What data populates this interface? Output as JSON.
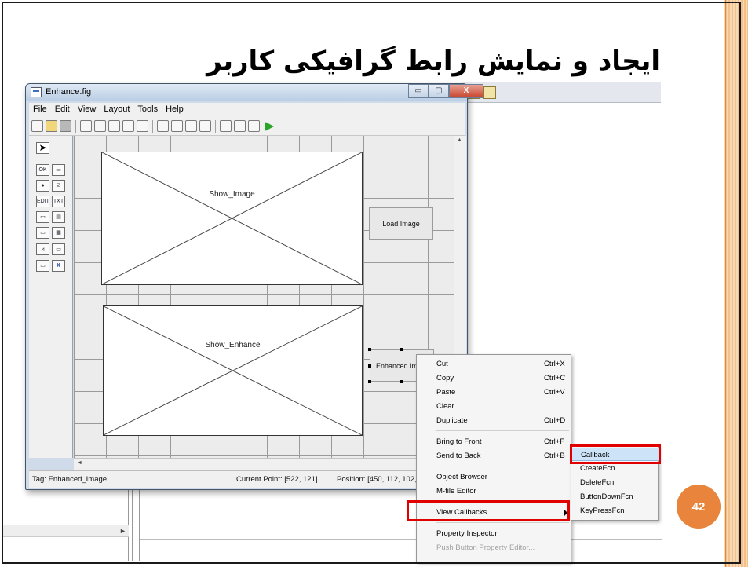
{
  "slide": {
    "title": "ایجاد و نمایش رابط گرافیکی کاربر",
    "page_number": "42"
  },
  "window": {
    "title": "Enhance.fig",
    "buttons": [
      "▭",
      "▢",
      "X"
    ]
  },
  "menubar": [
    "File",
    "Edit",
    "View",
    "Layout",
    "Tools",
    "Help"
  ],
  "palette": {
    "labels": [
      "OK",
      "▭",
      "●",
      "☑",
      "EDIT",
      "TXT",
      "▭",
      "▤",
      "▭",
      "▦",
      "⩘",
      "▭",
      "▭",
      "X"
    ]
  },
  "canvas": {
    "axes1_label": "Show_Image",
    "axes2_label": "Show_Enhance",
    "button1_label": "Load Image",
    "button2_label": "Enhanced Im"
  },
  "statusbar": {
    "tag": "Tag: Enhanced_Image",
    "current_point": "Current Point:  [522, 121]",
    "position": "Position: [450, 112, 102,"
  },
  "context_menu": {
    "items": [
      {
        "label": "Cut",
        "shortcut": "Ctrl+X"
      },
      {
        "label": "Copy",
        "shortcut": "Ctrl+C"
      },
      {
        "label": "Paste",
        "shortcut": "Ctrl+V"
      },
      {
        "label": "Clear",
        "shortcut": ""
      },
      {
        "label": "Duplicate",
        "shortcut": "Ctrl+D"
      },
      {
        "label": "Bring to Front",
        "shortcut": "Ctrl+F"
      },
      {
        "label": "Send to Back",
        "shortcut": "Ctrl+B"
      },
      {
        "label": "Object Browser",
        "shortcut": ""
      },
      {
        "label": "M-file Editor",
        "shortcut": ""
      },
      {
        "label": "View Callbacks",
        "shortcut": ""
      },
      {
        "label": "Property Inspector",
        "shortcut": ""
      },
      {
        "label": "Push Button Property Editor...",
        "shortcut": ""
      }
    ]
  },
  "submenu": {
    "items": [
      "Callback",
      "CreateFcn",
      "DeleteFcn",
      "ButtonDownFcn",
      "KeyPressFcn"
    ]
  },
  "colors": {
    "highlight": "#e00000",
    "page_number_bg": "#e9843c",
    "accent_strip": "#f3c08a"
  }
}
